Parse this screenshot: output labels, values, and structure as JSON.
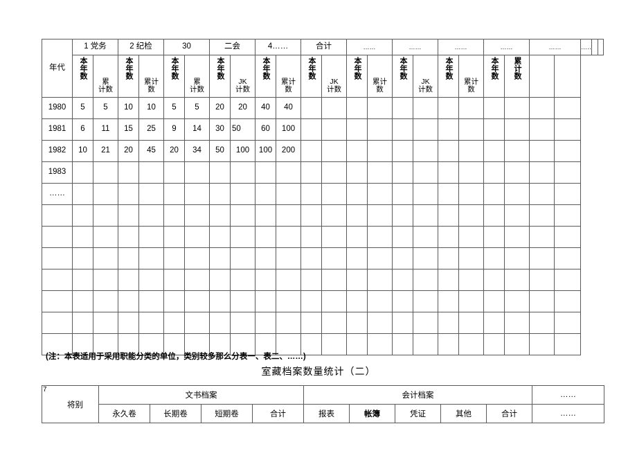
{
  "document": {
    "note": "(注：本表适用于采用职能分类的单位，类别较多那么分表一、表二、……)",
    "second_title": "室藏档案数量统计（二）"
  },
  "main_table": {
    "corner_label": "年代",
    "group_headers": [
      "1 党务",
      "2 纪检",
      "30",
      "二会",
      "4……",
      "合计",
      "……",
      "……",
      "……",
      "……",
      "……",
      "……",
      "",
      ""
    ],
    "sub_headers": [
      "本年数",
      "累计数",
      "本年数",
      "累计数",
      "本年数",
      "累计数",
      "本年数",
      "JK计数",
      "本年数",
      "累计数",
      "本年数",
      "JK计数",
      "本年数",
      "累计数",
      "本年数",
      "JK计数",
      "本年数",
      "累计数",
      "本年数",
      "累计数",
      "",
      ""
    ],
    "sub_header_parts": [
      {
        "top": "本年数",
        "kind": "vertical"
      },
      {
        "top": "累",
        "bottom": "计数",
        "kind": "stack"
      },
      {
        "top": "本年数",
        "kind": "vertical"
      },
      {
        "top": "累计",
        "bottom": "数",
        "kind": "stack"
      },
      {
        "top": "本年数",
        "kind": "vertical"
      },
      {
        "top": "累",
        "bottom": "计数",
        "kind": "stack"
      },
      {
        "top": "本年数",
        "kind": "vertical"
      },
      {
        "top": "JK",
        "bottom": "计数",
        "kind": "stack"
      },
      {
        "top": "本年数",
        "kind": "vertical"
      },
      {
        "top": "累计",
        "bottom": "数",
        "kind": "stack"
      },
      {
        "top": "本年数",
        "kind": "vertical"
      },
      {
        "top": "JK",
        "bottom": "计数",
        "kind": "stack"
      },
      {
        "top": "本年数",
        "kind": "vertical"
      },
      {
        "top": "累计",
        "bottom": "数",
        "kind": "stack"
      },
      {
        "top": "本年数",
        "kind": "vertical"
      },
      {
        "top": "JK",
        "bottom": "计数",
        "kind": "stack"
      },
      {
        "top": "本年数",
        "kind": "vertical"
      },
      {
        "top": "累计",
        "bottom": "数",
        "kind": "stack"
      },
      {
        "top": "本年数",
        "kind": "vertical"
      },
      {
        "top": "累计数",
        "kind": "vertical"
      },
      {
        "top": "",
        "kind": "blank"
      },
      {
        "top": "",
        "kind": "blank"
      }
    ],
    "rows": [
      {
        "year": "1980",
        "values": [
          "5",
          "5",
          "10",
          "10",
          "5",
          "5",
          "20",
          "20",
          "40",
          "40",
          "",
          "",
          "",
          "",
          "",
          "",
          "",
          "",
          "",
          "",
          "",
          ""
        ]
      },
      {
        "year": "1981",
        "values": [
          "6",
          "11",
          "15",
          "25",
          "9",
          "14",
          "30",
          "50",
          "60",
          "100",
          "",
          "",
          "",
          "",
          "",
          "",
          "",
          "",
          "",
          "",
          "",
          ""
        ],
        "left_align_index": 7
      },
      {
        "year": "1982",
        "values": [
          "10",
          "21",
          "20",
          "45",
          "20",
          "34",
          "50",
          "100",
          "100",
          "200",
          "",
          "",
          "",
          "",
          "",
          "",
          "",
          "",
          "",
          "",
          "",
          ""
        ]
      },
      {
        "year": "1983",
        "values": [
          "",
          "",
          "",
          "",
          "",
          "",
          "",
          "",
          "",
          "",
          "",
          "",
          "",
          "",
          "",
          "",
          "",
          "",
          "",
          "",
          "",
          ""
        ]
      },
      {
        "year": "……",
        "values": [
          "",
          "",
          "",
          "",
          "",
          "",
          "",
          "",
          "",
          "",
          "",
          "",
          "",
          "",
          "",
          "",
          "",
          "",
          "",
          "",
          "",
          ""
        ]
      },
      {
        "year": "",
        "values": [
          "",
          "",
          "",
          "",
          "",
          "",
          "",
          "",
          "",
          "",
          "",
          "",
          "",
          "",
          "",
          "",
          "",
          "",
          "",
          "",
          "",
          ""
        ]
      },
      {
        "year": "",
        "values": [
          "",
          "",
          "",
          "",
          "",
          "",
          "",
          "",
          "",
          "",
          "",
          "",
          "",
          "",
          "",
          "",
          "",
          "",
          "",
          "",
          "",
          ""
        ]
      },
      {
        "year": "",
        "values": [
          "",
          "",
          "",
          "",
          "",
          "",
          "",
          "",
          "",
          "",
          "",
          "",
          "",
          "",
          "",
          "",
          "",
          "",
          "",
          "",
          "",
          ""
        ]
      },
      {
        "year": "",
        "values": [
          "",
          "",
          "",
          "",
          "",
          "",
          "",
          "",
          "",
          "",
          "",
          "",
          "",
          "",
          "",
          "",
          "",
          "",
          "",
          "",
          "",
          ""
        ]
      },
      {
        "year": "",
        "values": [
          "",
          "",
          "",
          "",
          "",
          "",
          "",
          "",
          "",
          "",
          "",
          "",
          "",
          "",
          "",
          "",
          "",
          "",
          "",
          "",
          "",
          ""
        ]
      },
      {
        "year": "",
        "values": [
          "",
          "",
          "",
          "",
          "",
          "",
          "",
          "",
          "",
          "",
          "",
          "",
          "",
          "",
          "",
          "",
          "",
          "",
          "",
          "",
          "",
          ""
        ]
      },
      {
        "year": "",
        "values": [
          "",
          "",
          "",
          "",
          "",
          "",
          "",
          "",
          "",
          "",
          "",
          "",
          "",
          "",
          "",
          "",
          "",
          "",
          "",
          "",
          "",
          ""
        ]
      }
    ]
  },
  "second_table": {
    "serial": "7",
    "corner_label": "将别",
    "group_headers": [
      {
        "label": "文书档案",
        "span": 4
      },
      {
        "label": "会计档案",
        "span": 5
      },
      {
        "label": "……",
        "span": 1
      }
    ],
    "sub_headers": [
      "永久卷",
      "长期卷",
      "短期卷",
      "合计",
      "报表",
      "帐簿",
      "凭证",
      "其他",
      "合计",
      "……"
    ],
    "bold_sub_header_index": 5
  }
}
